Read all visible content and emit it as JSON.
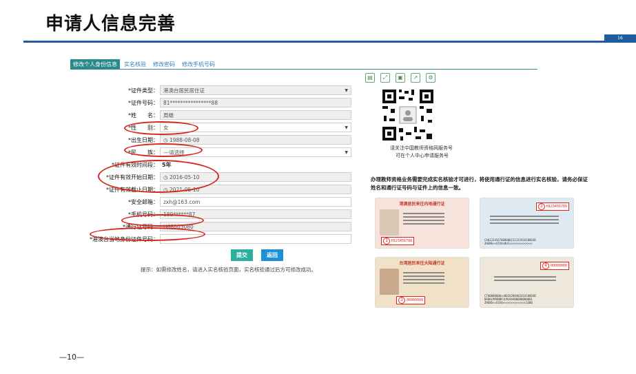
{
  "slide": {
    "title": "申请人信息完善",
    "page_number": "16",
    "footer": "—10—"
  },
  "tabs": [
    {
      "label": "修改个人身份信息",
      "active": true
    },
    {
      "label": "实名核验",
      "active": false
    },
    {
      "label": "修改密码",
      "active": false
    },
    {
      "label": "修改手机号码",
      "active": false
    }
  ],
  "toolbar_icons": [
    "document-icon",
    "expand-icon",
    "image-icon",
    "share-icon",
    "settings-icon"
  ],
  "form": {
    "rows": [
      {
        "label": "*证件类型：",
        "value": "港澳台居民居住证",
        "type": "select"
      },
      {
        "label": "*证件号码：",
        "value": "81****************88",
        "type": "text"
      },
      {
        "label": "*姓　　名：",
        "value": "周雄",
        "type": "text"
      },
      {
        "label": "*性　　别：",
        "value": "女",
        "type": "select"
      },
      {
        "label": "*出生日期：",
        "value": "1988-08-08",
        "type": "date"
      },
      {
        "label": "*民　　族：",
        "value": "---请选择",
        "type": "select"
      },
      {
        "label": "*证件有效时间段：",
        "value": "5年",
        "type": "plain"
      },
      {
        "label": "*证件有效开始日期：",
        "value": "2016-05-10",
        "type": "date"
      },
      {
        "label": "*证件有效截止日期：",
        "value": "2021-05-10",
        "type": "date"
      },
      {
        "label": "*安全邮箱：",
        "value": "zxh@163.com",
        "type": "text"
      },
      {
        "label": "*手机号码：",
        "value": "189******87",
        "type": "text"
      },
      {
        "label": "*通行证号码：",
        "value": "H68003080",
        "type": "text"
      },
      {
        "label": "*港澳台当地身份证件号码：",
        "value": "",
        "type": "text"
      }
    ],
    "submit_label": "提交",
    "reset_label": "返回",
    "hint": "提示：如需修改姓名，请进入实名核验页面，实名核验通过后方可修改成功。"
  },
  "qr": {
    "caption_line1": "请关注中国教师资格网服务号",
    "caption_line2": "可在个人中心申请服务号"
  },
  "note": "办理教师资格业务需要完成实名核验才可进行，将使用通行证的信息进行实名核验，请务必保证姓名和通行证号码与证件上的信息一致。",
  "cards": [
    {
      "header": "港澳居民来往内地通行证",
      "badge": "1",
      "number": "H123456788",
      "mrz": ""
    },
    {
      "header": "",
      "badge": "2",
      "number": "H123456789",
      "mrz": "CAH123456780000021112191810803B ZHENG<<XIAO<HUI<<<<<<<<<<<<<<"
    },
    {
      "header": "台湾居民来往大陆通行证",
      "badge": "3",
      "number": "00000000",
      "mrz": ""
    },
    {
      "header": "",
      "badge": "4",
      "number": "00000000",
      "mrz": "CT00000000<<002620040241810803B NSKKLMPONBPJLMLKAAB0000000001 ZHENG<<XIAO<<<<<<<<<<<<<<3300"
    }
  ],
  "colors": {
    "accent": "#1f5d9e",
    "tab_active": "#2a8a8a",
    "button": "#1e90d6",
    "annotation": "#d9261c"
  }
}
